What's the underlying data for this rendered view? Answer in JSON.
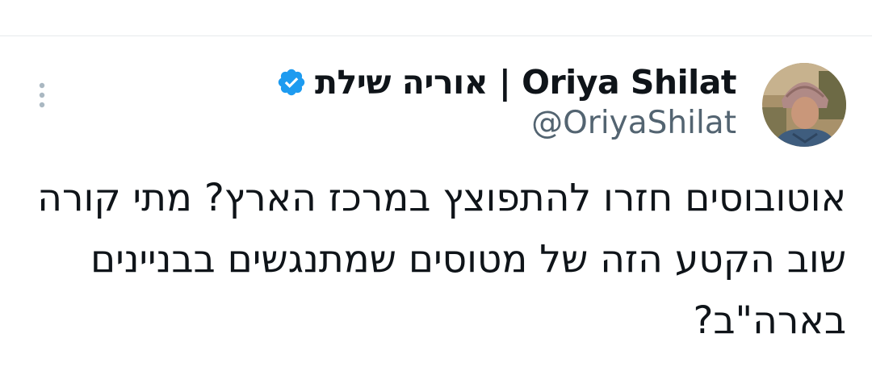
{
  "author": {
    "display_name": "אוריה שילת | Oriya Shilat",
    "handle": "@OriyaShilat",
    "verified": true
  },
  "tweet": {
    "text": "אוטובוסים חזרו להתפוצץ במרכז הארץ? מתי קורה שוב הקטע הזה של מטוסים שמתנגשים בבניינים בארה\"ב?"
  },
  "colors": {
    "verified_badge": "#1d9bf0",
    "text_primary": "#0f1419",
    "text_secondary": "#536471",
    "divider": "#e6e9ec"
  },
  "icons": {
    "verified": "verified-badge-icon",
    "more": "more-options-icon"
  }
}
